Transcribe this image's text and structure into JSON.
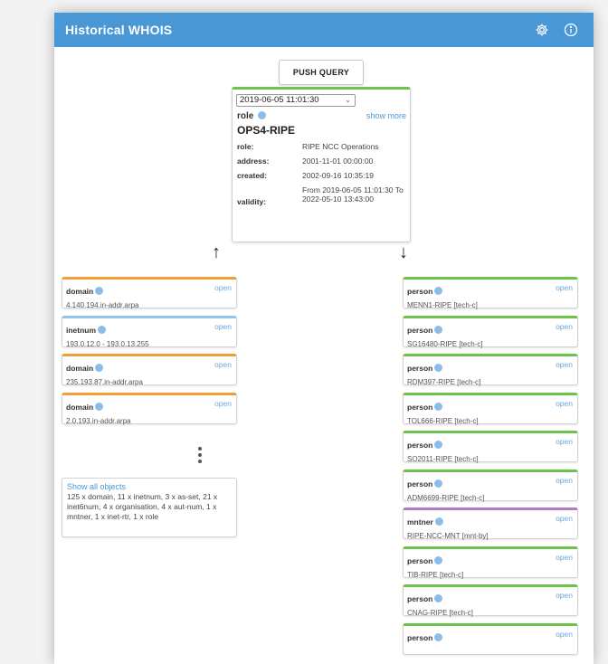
{
  "header": {
    "title": "Historical WHOIS",
    "settings_icon": "gear-icon",
    "info_icon": "info-icon"
  },
  "push_button": "PUSH QUERY",
  "main": {
    "date_select": "2019-06-05 11:01:30",
    "type": "role",
    "show_more": "show more",
    "name": "OPS4-RIPE",
    "attributes": [
      {
        "key": "role:",
        "value": "RIPE NCC Operations"
      },
      {
        "key": "address:",
        "value": "2001-11-01 00:00:00"
      },
      {
        "key": "created:",
        "value": "2002-09-16 10:35:19"
      },
      {
        "key": "validity:",
        "value": "From 2019-06-05 11:01:30 To 2022-05-10 13:43:00"
      }
    ]
  },
  "arrows": {
    "up": "↑",
    "down": "↓"
  },
  "colors": {
    "domain": "#f0a030",
    "inetnum": "#8fc4ee",
    "person": "#6cc24a",
    "mntner": "#b07cc6",
    "accent": "#4a97d6"
  },
  "left_cards": [
    {
      "type": "domain",
      "value": "4.140.194.in-addr.arpa",
      "open": "open",
      "color": "#f0a030"
    },
    {
      "type": "inetnum",
      "value": "193.0.12.0 - 193.0.13.255",
      "open": "open",
      "color": "#8fc4ee"
    },
    {
      "type": "domain",
      "value": "235.193.87.in-addr.arpa",
      "open": "open",
      "color": "#f0a030"
    },
    {
      "type": "domain",
      "value": "2.0.193.in-addr.arpa",
      "open": "open",
      "color": "#f0a030"
    }
  ],
  "summary": {
    "link": "Show all objects",
    "text": "125 x domain, 11 x inetnum, 3 x as-set, 21 x inet6num, 4 x organisation, 4 x aut-num, 1 x mntner, 1 x inet-rtr, 1 x role"
  },
  "right_cards": [
    {
      "type": "person",
      "value": "MENN1-RIPE [tech-c]",
      "open": "open",
      "color": "#6cc24a"
    },
    {
      "type": "person",
      "value": "SG16480-RIPE [tech-c]",
      "open": "open",
      "color": "#6cc24a"
    },
    {
      "type": "person",
      "value": "RDM397-RIPE [tech-c]",
      "open": "open",
      "color": "#6cc24a"
    },
    {
      "type": "person",
      "value": "TOL666-RIPE [tech-c]",
      "open": "open",
      "color": "#6cc24a"
    },
    {
      "type": "person",
      "value": "SO2011-RIPE [tech-c]",
      "open": "open",
      "color": "#6cc24a"
    },
    {
      "type": "person",
      "value": "ADM6699-RIPE [tech-c]",
      "open": "open",
      "color": "#6cc24a"
    },
    {
      "type": "mntner",
      "value": "RIPE-NCC-MNT [mnt-by]",
      "open": "open",
      "color": "#b07cc6"
    },
    {
      "type": "person",
      "value": "TIB-RIPE [tech-c]",
      "open": "open",
      "color": "#6cc24a"
    },
    {
      "type": "person",
      "value": "CNAG-RIPE [tech-c]",
      "open": "open",
      "color": "#6cc24a"
    },
    {
      "type": "person",
      "value": "",
      "open": "open",
      "color": "#6cc24a"
    }
  ]
}
